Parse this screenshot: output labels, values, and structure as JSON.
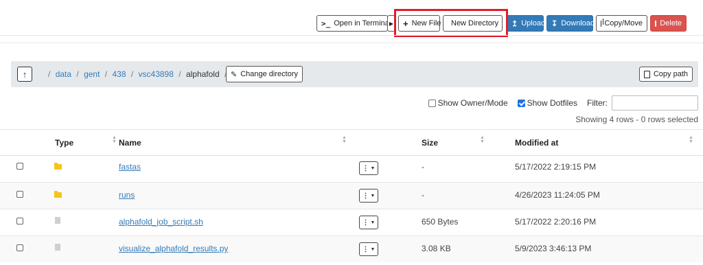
{
  "toolbar": {
    "open_terminal": "Open in Terminal",
    "new_file": "New File",
    "new_directory": "New Directory",
    "upload": "Upload",
    "download": "Download",
    "copy_move": "Copy/Move",
    "delete": "Delete"
  },
  "breadcrumb": {
    "items": [
      "data",
      "gent",
      "438",
      "vsc43898"
    ],
    "current": "alphafold",
    "separator": "/",
    "change_directory": "Change directory",
    "copy_path": "Copy path"
  },
  "filters": {
    "show_owner_mode": "Show Owner/Mode",
    "show_owner_mode_checked": false,
    "show_dotfiles": "Show Dotfiles",
    "show_dotfiles_checked": true,
    "filter_label": "Filter:",
    "filter_value": ""
  },
  "table": {
    "summary": "Showing 4 rows - 0 rows selected",
    "columns": {
      "type": "Type",
      "name": "Name",
      "size": "Size",
      "modified": "Modified at"
    },
    "rows": [
      {
        "kind": "folder-icon",
        "name": "fastas",
        "size": "-",
        "modified": "5/17/2022 2:19:15 PM"
      },
      {
        "kind": "folder-icon",
        "name": "runs",
        "size": "-",
        "modified": "4/26/2023 11:24:05 PM"
      },
      {
        "kind": "file-icon",
        "name": "alphafold_job_script.sh",
        "size": "650 Bytes",
        "modified": "5/17/2022 2:20:16 PM"
      },
      {
        "kind": "file-icon",
        "name": "visualize_alphafold_results.py",
        "size": "3.08 KB",
        "modified": "5/9/2023 3:46:13 PM"
      }
    ]
  },
  "colors": {
    "primary": "#337ab7",
    "danger": "#d9534f",
    "highlight": "#e01d2a",
    "folder": "#f5c518"
  }
}
